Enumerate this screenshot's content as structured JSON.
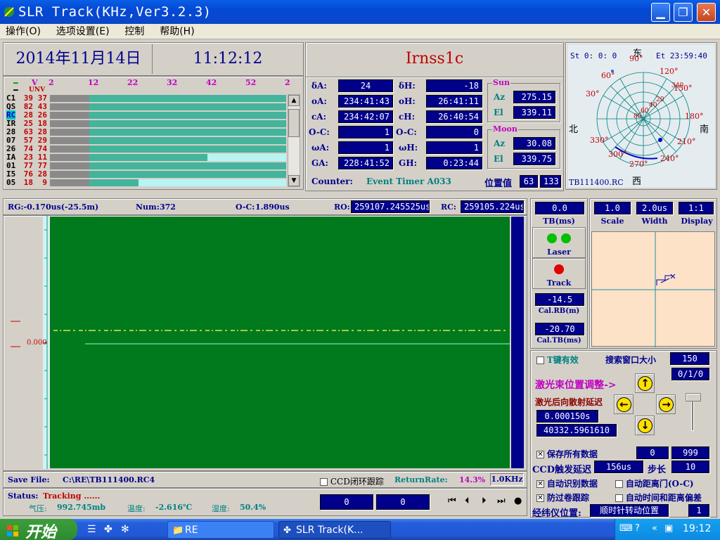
{
  "window": {
    "title": "SLR Track(KHz,Ver3.2.3)"
  },
  "menu": [
    "操作(O)",
    "选项设置(E)",
    "控制",
    "帮助(H)"
  ],
  "header": {
    "date": "2014年11月14日",
    "time": "11:12:12",
    "satellite": "Irnss1c"
  },
  "satlist": {
    "header_v": "V",
    "header_unv": "UNV",
    "ticks": [
      "2",
      "12",
      "22",
      "32",
      "42",
      "52",
      "2"
    ],
    "rows": [
      {
        "name": "C1",
        "v": "39",
        "u": "37",
        "fill": 1.0
      },
      {
        "name": "QS",
        "v": "82",
        "u": "43",
        "fill": 1.0
      },
      {
        "name": "RC",
        "v": "28",
        "u": "26",
        "fill": 1.0,
        "selected": true
      },
      {
        "name": "IR",
        "v": "25",
        "u": "18",
        "fill": 1.0
      },
      {
        "name": "28",
        "v": "63",
        "u": "28",
        "fill": 1.0
      },
      {
        "name": "07",
        "v": "57",
        "u": "29",
        "fill": 1.0
      },
      {
        "name": "26",
        "v": "74",
        "u": "74",
        "fill": 1.0
      },
      {
        "name": "IA",
        "v": "23",
        "u": "11",
        "fill": 0.6
      },
      {
        "name": "01",
        "v": "77",
        "u": "77",
        "fill": 1.0
      },
      {
        "name": "I5",
        "v": "76",
        "u": "28",
        "fill": 1.0
      },
      {
        "name": "05",
        "v": "18",
        "u": "9",
        "fill": 0.25
      }
    ]
  },
  "params": {
    "dA_label": "δA:",
    "dA": "24",
    "dH_label": "δH:",
    "dH": "-18",
    "oA_label": "oA:",
    "oA": "234:41:43",
    "oH_label": "oH:",
    "oH": "26:41:11",
    "cA_label": "cA:",
    "cA": "234:42:07",
    "cH_label": "cH:",
    "cH": "26:40:54",
    "oc1_label": "O-C:",
    "oc1": "1",
    "oc2_label": "O-C:",
    "oc2": "0",
    "wA_label": "ωA:",
    "wA": "1",
    "wH_label": "ωH:",
    "wH": "1",
    "GA_label": "GA:",
    "GA": "228:41:52",
    "GH_label": "GH:",
    "GH": "0:23:44",
    "sun_label": "Sun",
    "sun_az_label": "Az",
    "sun_az": "275.15",
    "sun_el_label": "El",
    "sun_el": "339.11",
    "moon_label": "Moon",
    "moon_az_label": "Az",
    "moon_az": "30.08",
    "moon_el_label": "El",
    "moon_el": "339.75",
    "counter_label": "Counter:",
    "counter_value": "Event Timer A033",
    "pos_label": "位置值",
    "pos1": "63",
    "pos2": "133"
  },
  "polar": {
    "st": "St  0: 0: 0",
    "et": "Et 23:59:40",
    "east": "东",
    "west": "西",
    "north": "北",
    "south": "南",
    "file": "TB111400.RC",
    "az_labels": [
      "90°",
      "120°",
      "150°",
      "180°",
      "210°",
      "240°",
      "270°",
      "300°",
      "330°",
      "30°",
      "60°"
    ],
    "el_labels": [
      "20",
      "40",
      "60",
      "80",
      "340"
    ]
  },
  "range": {
    "rg": "RG:-0.170us(-25.5m)",
    "num_label": "Num:",
    "num": "372",
    "oc_label": "O-C:",
    "oc": "1.890us",
    "ro_label": "RO:",
    "ro": "259107.245525us",
    "rc_label": "RC:",
    "rc": "259105.224us",
    "zero": "0.000"
  },
  "savebar": {
    "save_label": "Save File:",
    "save_path": "C:\\RE\\TB111400.RC4",
    "ccd_loop": "CCD闭环跟踪",
    "rr_label": "ReturnRate:",
    "rr": "14.3%",
    "freq": "1.0KHz"
  },
  "status": {
    "status_label": "Status:",
    "status_value": "Tracking ......",
    "pressure_label": "气压:",
    "pressure": "992.745mb",
    "temp_label": "温度:",
    "temp": "-2.616℃",
    "humidity_label": "湿度:",
    "humidity": "50.4%",
    "box1": "0",
    "box2": "0"
  },
  "controls": {
    "tb_value": "0.0",
    "tb_label": "TB(ms)",
    "scale_value": "1.0",
    "scale_label": "Scale",
    "width_value": "2.0us",
    "width_label": "Width",
    "display_value": "1:1",
    "display_label": "Display",
    "laser_label": "Laser",
    "track_label": "Track",
    "cal_rb_value": "-14.5",
    "cal_rb_label": "Cal.RB(m)",
    "cal_tb_value": "-20.70",
    "cal_tb_label": "Cal.TB(ms)",
    "tkey_label": "T键有效",
    "search_label": "搜索窗口大小",
    "search_value": "150",
    "ratio_value": "0/1/0",
    "beam_adjust": "激光束位置调整->",
    "backscatter_label": "激光后向散射延迟",
    "delay1": "0.000150s",
    "delay2": "40332.5961610",
    "save_all": "保存所有数据",
    "save_v1": "0",
    "save_v2": "999",
    "ccd_delay_label": "CCD触发延迟",
    "ccd_delay": "156us",
    "step_label": "步长",
    "step": "10",
    "auto_identify": "自动识别数据",
    "auto_gate": "自动距离门(O-C)",
    "anti_wind": "防过卷跟踪",
    "auto_time": "自动时间和距离偏差",
    "theo_label": "经纬仪位置:",
    "theo_value": "顺时针转动位置",
    "theo_num": "1"
  },
  "taskbar": {
    "start": "开始",
    "item1": "RE",
    "item2": "SLR Track(K...",
    "clock": "19:12"
  }
}
